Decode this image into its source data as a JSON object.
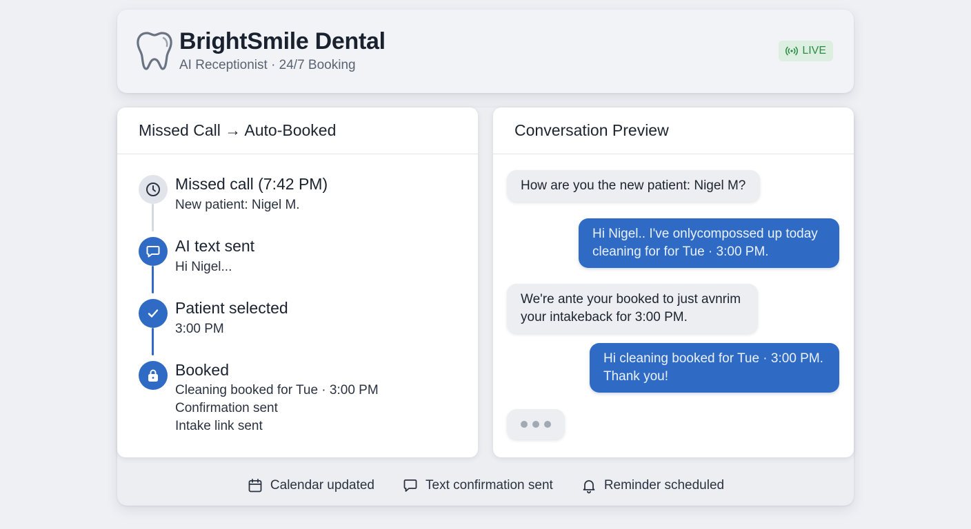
{
  "header": {
    "title": "BrightSmile Dental",
    "subtitle": "AI Receptionist · 24/7 Booking",
    "status_badge": "LIVE",
    "logo_icon": "tooth-icon",
    "status_color": "#2c8a45"
  },
  "timeline_panel": {
    "title": "Missed Call → Auto-Booked",
    "steps": [
      {
        "icon": "clock-icon",
        "title": "Missed call (7:42 PM)",
        "lines": [
          "New patient: Nigel M."
        ]
      },
      {
        "icon": "chat-bubble-icon",
        "title": "AI text sent",
        "lines": [
          "Hi Nigel..."
        ]
      },
      {
        "icon": "checkmark-icon",
        "title": "Patient selected",
        "lines": [
          "3:00 PM"
        ]
      },
      {
        "icon": "lock-icon",
        "title": "Booked",
        "lines": [
          "Cleaning booked for Tue · 3:00 PM",
          "Confirmation sent",
          "Intake link sent"
        ]
      }
    ]
  },
  "conversation_panel": {
    "title": "Conversation Preview",
    "messages": [
      {
        "from": "patient",
        "text": "How are you the new patient: Nigel M?"
      },
      {
        "from": "ai",
        "text": "Hi Nigel.. I've onlycompossed up today cleaning for for Tue · 3:00 PM."
      },
      {
        "from": "patient",
        "text": "We're ante your booked to just avnrim your intakeback for 3:00 PM."
      },
      {
        "from": "ai",
        "text": "Hi cleaning booked for Tue · 3:00 PM. Thank you!"
      }
    ],
    "typing_indicator": "typing-dots"
  },
  "footer": {
    "items": [
      {
        "icon": "calendar-icon",
        "label": "Calendar updated"
      },
      {
        "icon": "chat-bubble-icon",
        "label": "Text confirmation sent"
      },
      {
        "icon": "bell-icon",
        "label": "Reminder scheduled"
      }
    ]
  },
  "colors": {
    "accent": "#2f6bc4",
    "background": "#eef0f4",
    "live_badge_bg": "#ddefe1"
  }
}
